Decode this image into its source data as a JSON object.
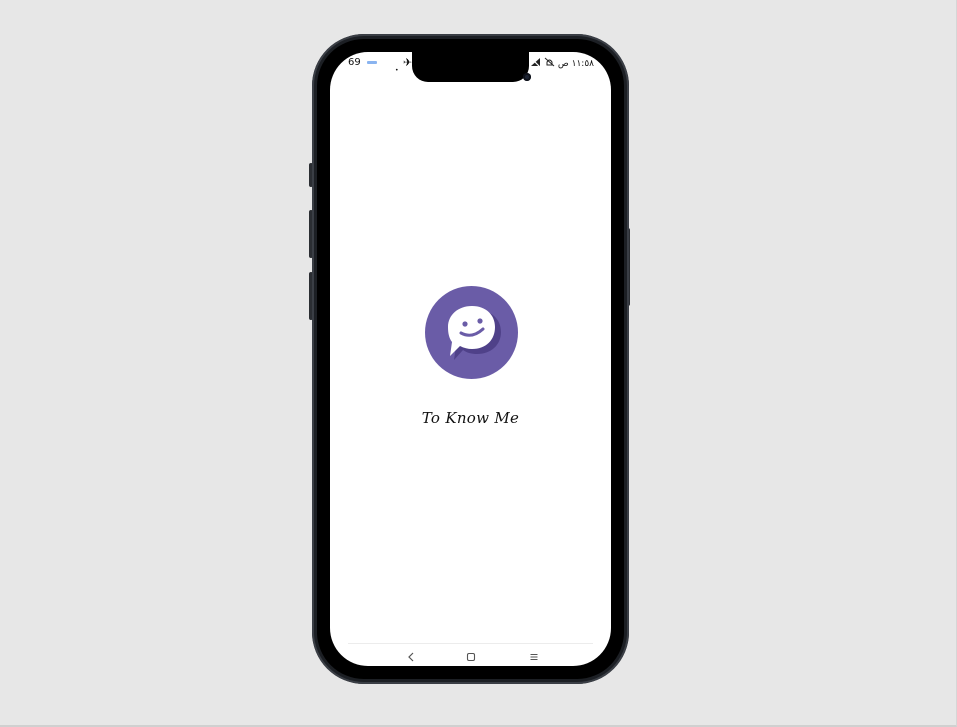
{
  "app": {
    "title": "To Know Me"
  },
  "status_bar": {
    "signal_text": "69",
    "time_text": "١١:٥٨ ص"
  },
  "icons": {
    "logo": "chat-bubble-smile-icon",
    "back": "back-chevron-icon",
    "home": "home-square-icon",
    "menu": "menu-lines-icon"
  },
  "colors": {
    "brand": "#6a5ca7",
    "brand_shadow": "#4f4189",
    "background": "#e7e7e7",
    "screen": "#ffffff"
  }
}
